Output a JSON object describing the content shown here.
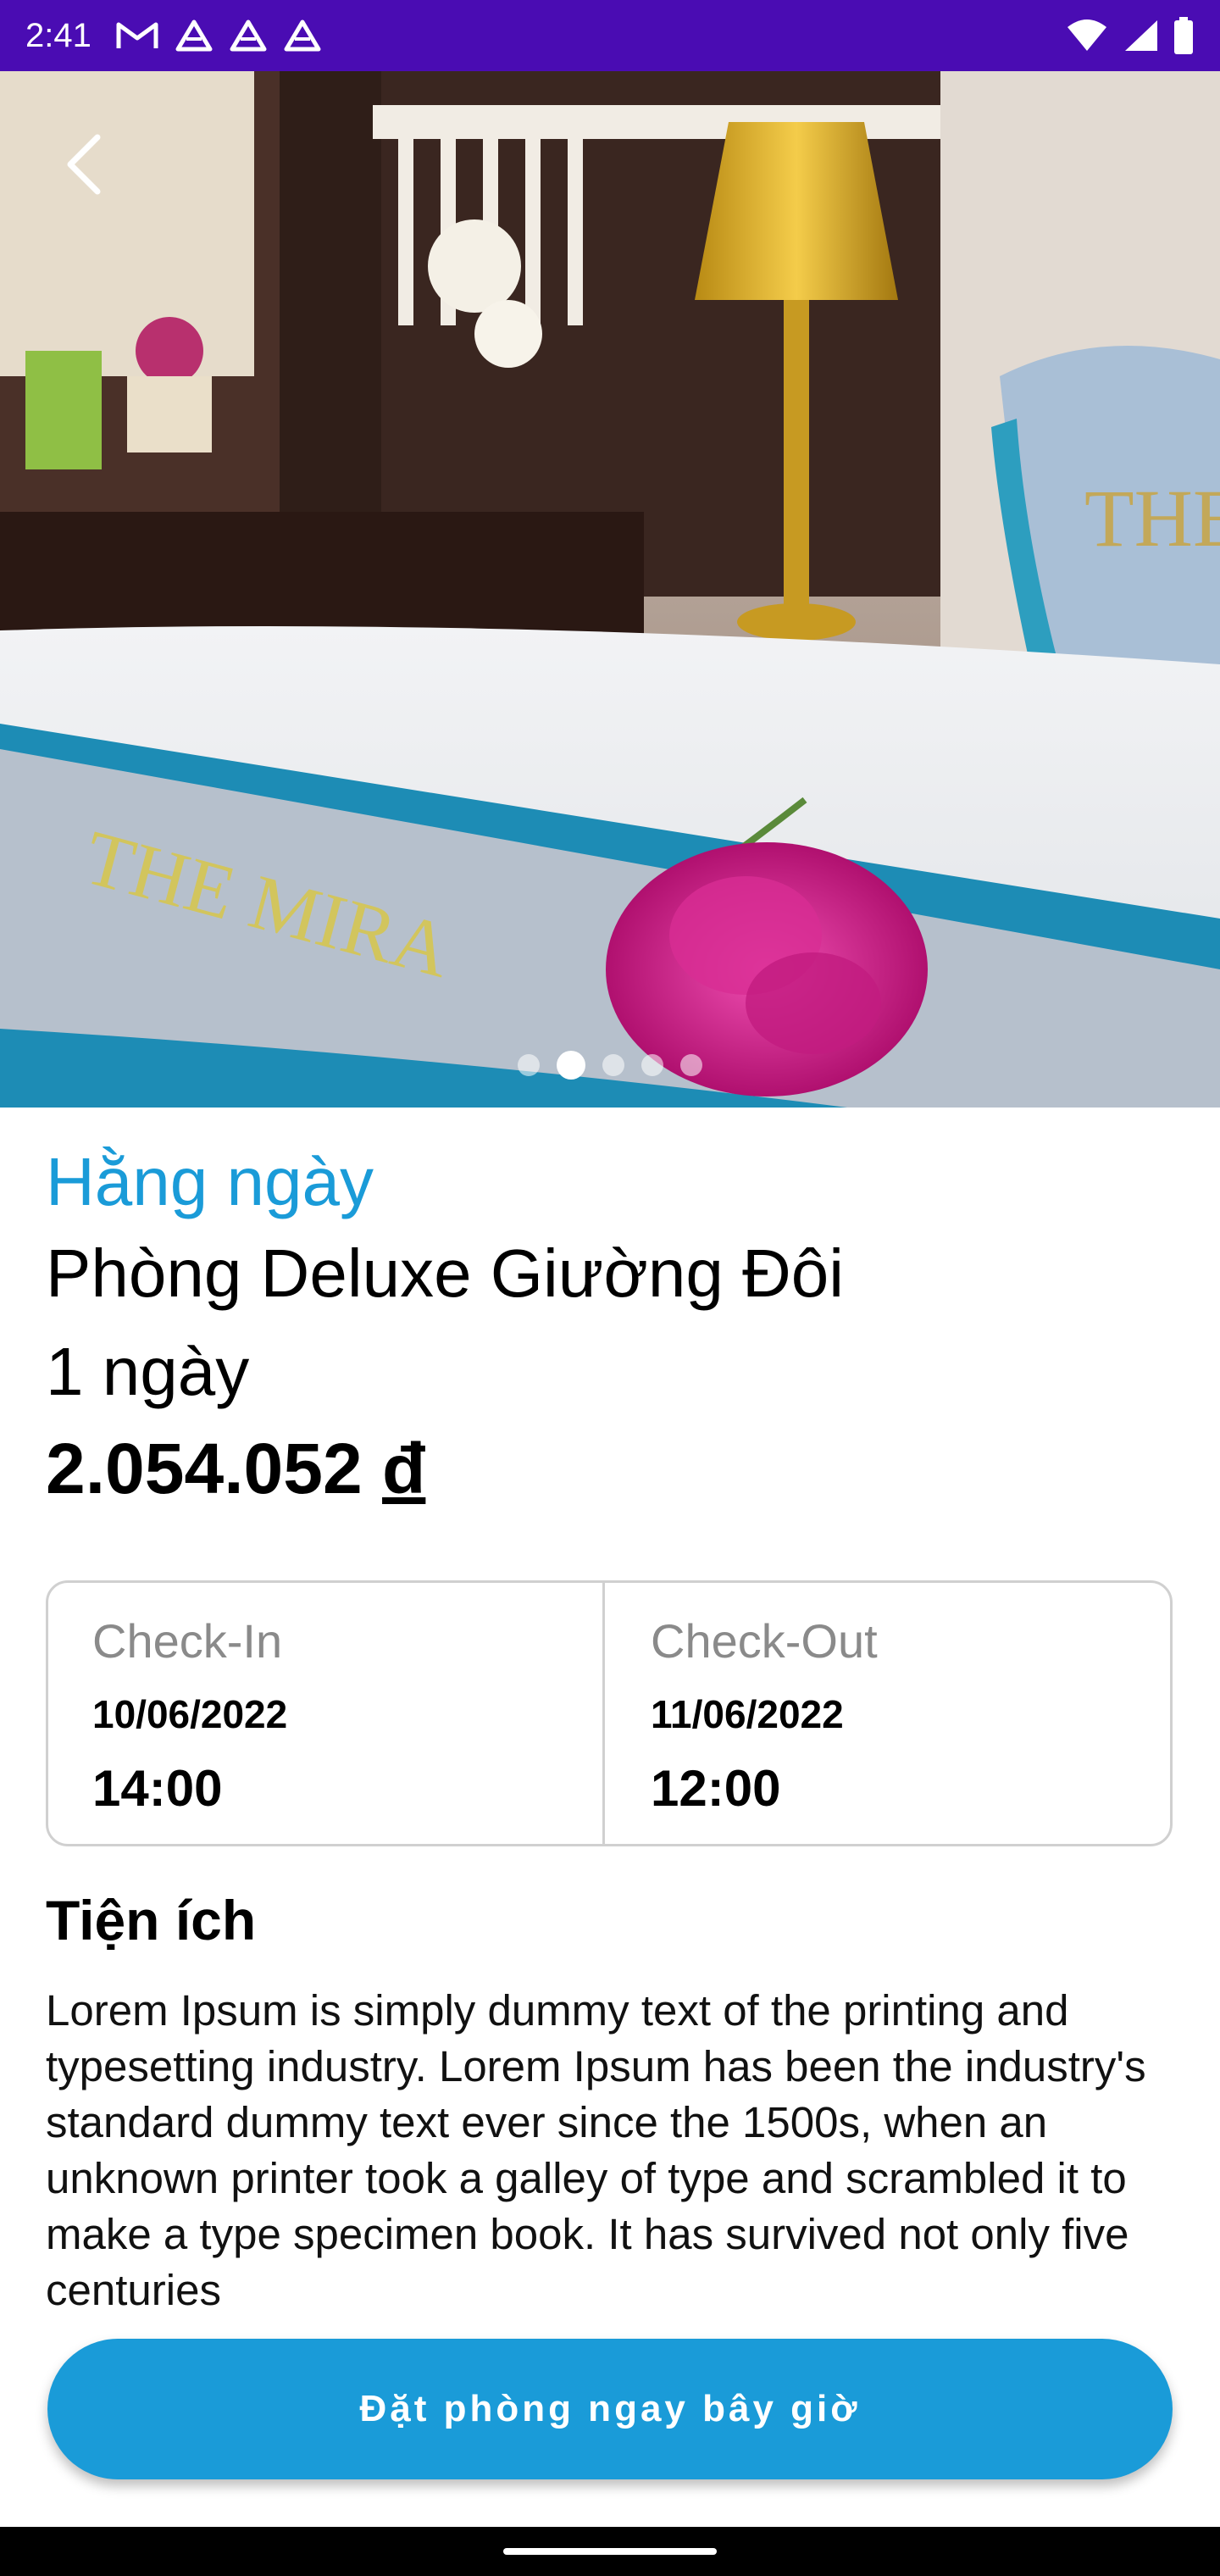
{
  "status_bar": {
    "time": "2:41",
    "left_icons": [
      "gmail-icon",
      "drive-icon",
      "drive-icon",
      "drive-icon"
    ],
    "right_icons": [
      "wifi-icon",
      "signal-icon",
      "battery-icon"
    ]
  },
  "hero": {
    "back_icon": "chevron-left-icon",
    "slides_count": 5,
    "active_slide": 2
  },
  "room": {
    "category": "Hằng ngày",
    "name": "Phòng Deluxe Giường Đôi",
    "duration": "1 ngày",
    "price_value": "2.054.052",
    "price_currency": "đ"
  },
  "checkin": {
    "label": "Check-In",
    "date": "10/06/2022",
    "time": "14:00"
  },
  "checkout": {
    "label": "Check-Out",
    "date": "11/06/2022",
    "time": "12:00"
  },
  "amenities": {
    "title": "Tiện ích",
    "description": "Lorem Ipsum is simply dummy text of the printing and typesetting industry. Lorem Ipsum has been the industry's standard dummy text ever since the 1500s, when an unknown printer took a galley of type and scrambled it to make a type specimen book. It has survived not only five centuries"
  },
  "actions": {
    "book_label": "Đặt phòng ngay bây giờ"
  },
  "colors": {
    "status_bar": "#4a0cb3",
    "accent": "#1a9bd8"
  }
}
